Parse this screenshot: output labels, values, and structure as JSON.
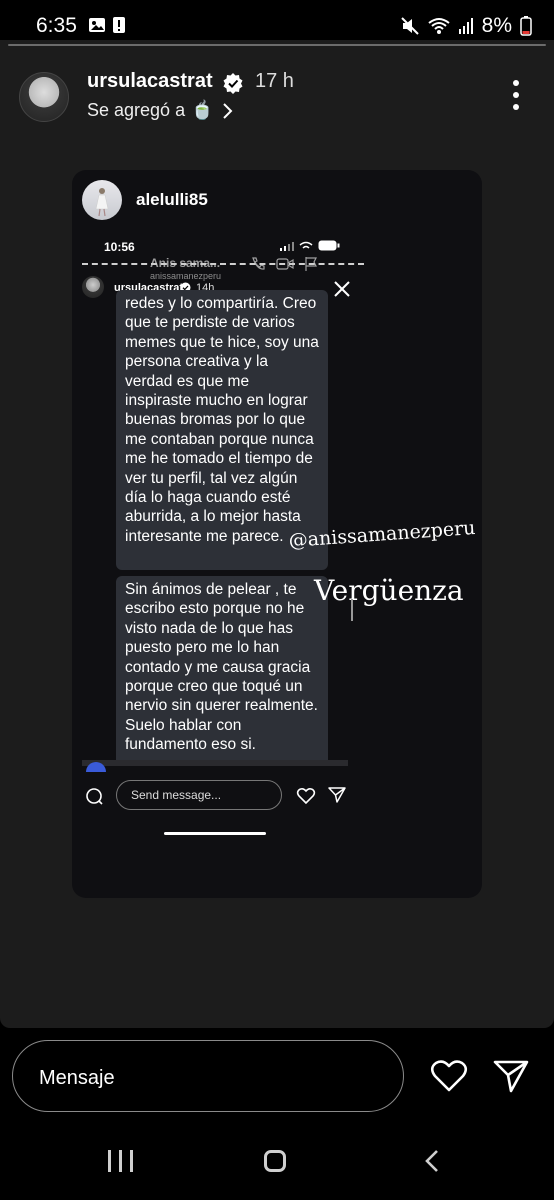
{
  "status": {
    "time": "6:35",
    "battery": "8%",
    "icons": [
      "image-icon",
      "alert-icon",
      "mute-icon",
      "wifi-icon",
      "signal-icon",
      "battery-icon"
    ]
  },
  "story": {
    "username": "ursulacastrat",
    "time": "17 h",
    "added_text": "Se agregó a",
    "added_emoji": "🍵"
  },
  "card": {
    "username": "alelulli85"
  },
  "shot": {
    "time": "10:56",
    "ghost_name": "Anis sama...",
    "ghost_sub": "anissamanezperu",
    "mini_user": "ursulacastrat",
    "mini_time": "14h",
    "dots": "...",
    "bubble1": "redes y lo compartiría. Creo que te perdiste de varios memes que te hice, soy una persona creativa y la verdad es que me inspiraste mucho en lograr buenas bromas por lo que me contaban porque nunca me he tomado el tiempo de ver tu perfil, tal vez algún día lo haga cuando esté aburrida, a lo mejor hasta interesante me parece.",
    "bubble2": "Sin ánimos de pelear , te escribo esto porque no he visto nada de lo que has puesto pero me lo han contado y me causa gracia porque creo que toqué un nervio sin querer realmente. Suelo hablar con fundamento eso si.",
    "sticker_handle": "@anissamanezperu",
    "sticker_text": "Vergüenza",
    "send_placeholder": "Send message..."
  },
  "reply": {
    "placeholder": "Mensaje"
  },
  "colors": {
    "background": "#000000",
    "story_bg": "#1c1c1c",
    "card_bg": "#0f0f12",
    "bubble": "#2d3037"
  }
}
